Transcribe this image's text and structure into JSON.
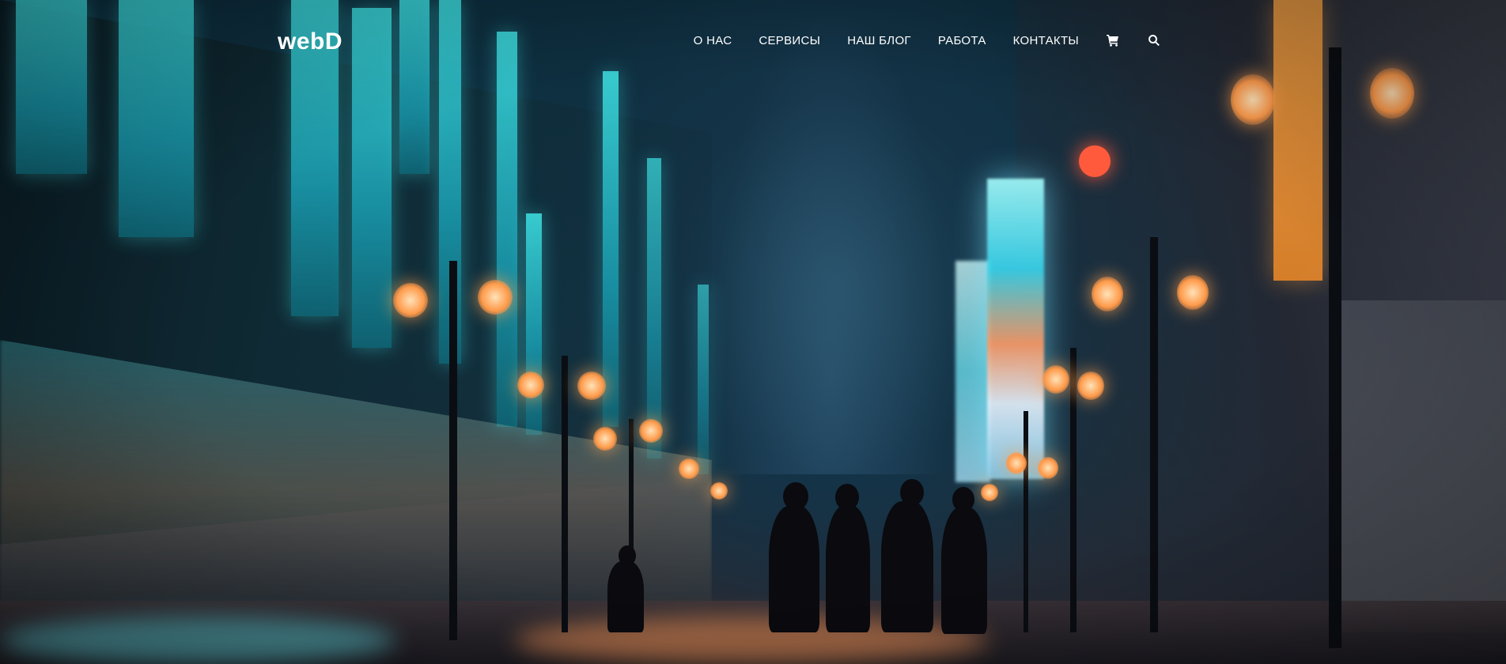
{
  "brand": {
    "logo_text": "webD"
  },
  "nav": {
    "items": [
      {
        "label": "О НАС"
      },
      {
        "label": "СЕРВИСЫ"
      },
      {
        "label": "НАШ БЛОГ"
      },
      {
        "label": "РАБОТА"
      },
      {
        "label": "КОНТАКТЫ"
      }
    ],
    "icons": [
      "cart-icon",
      "search-icon"
    ]
  },
  "colors": {
    "text": "#ffffff",
    "neon_cyan": "#3fe6e8",
    "lamp_orange": "#ff9a4a",
    "sky": "#0d2d3d"
  },
  "hero": {
    "background": "night-city-street-photo"
  }
}
